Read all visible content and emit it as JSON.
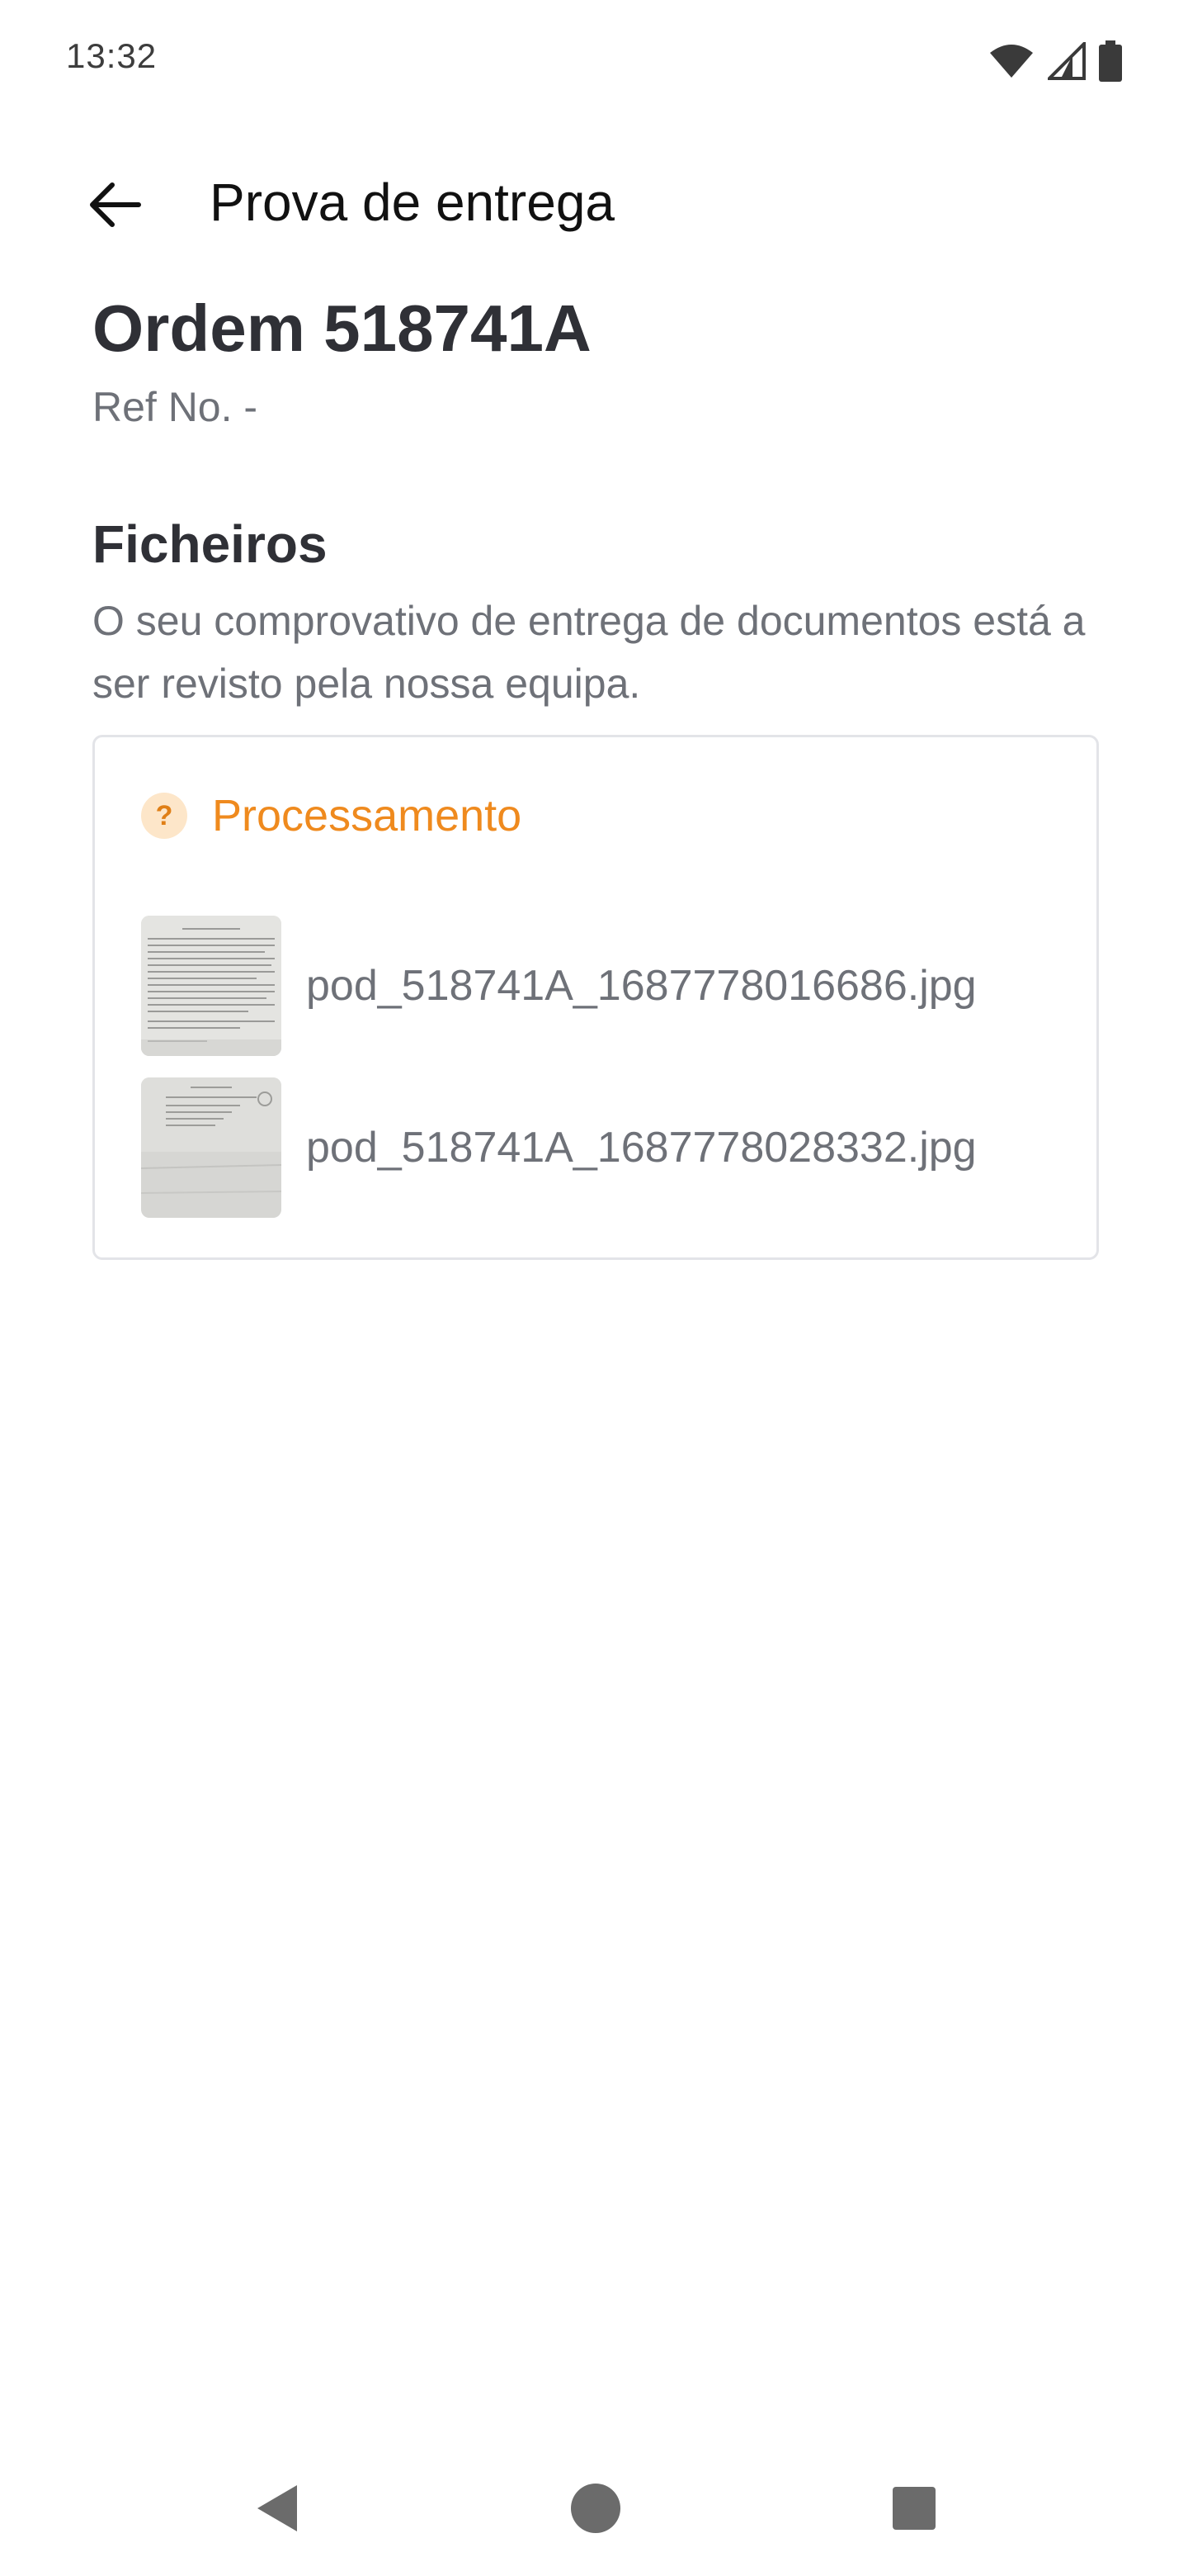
{
  "status_bar": {
    "time": "13:32",
    "icons": [
      "wifi-icon",
      "cellular-signal-icon",
      "battery-icon"
    ]
  },
  "app_bar": {
    "back_icon": "arrow-left-icon",
    "title": "Prova de entrega"
  },
  "order": {
    "title": "Ordem 518741A",
    "ref": "Ref No. -"
  },
  "files": {
    "heading": "Ficheiros",
    "description": "O seu comprovativo de entrega de documentos está a ser revisto pela nossa equipa.",
    "status": {
      "icon_symbol": "?",
      "label": "Processamento",
      "color": "#ef8a1e"
    },
    "items": [
      {
        "name": "pod_518741A_1687778016686.jpg"
      },
      {
        "name": "pod_518741A_1687778028332.jpg"
      }
    ]
  },
  "nav_bar": {
    "icons": [
      "nav-back-icon",
      "nav-home-icon",
      "nav-recents-icon"
    ]
  }
}
